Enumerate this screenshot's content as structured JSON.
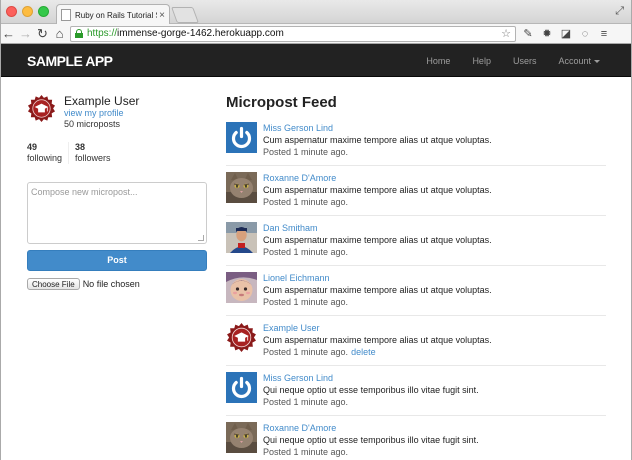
{
  "browser": {
    "tab_title": "Ruby on Rails Tutorial Sam",
    "url_scheme": "https://",
    "url_rest": "immense-gorge-1462.herokuapp.com",
    "icons": [
      "back-icon",
      "forward-icon",
      "reload-icon",
      "home-icon",
      "lock-icon",
      "star-icon",
      "extension-icon",
      "settings-icon",
      "menu-icon"
    ]
  },
  "navbar": {
    "logo": "SAMPLE APP",
    "links": {
      "home": "Home",
      "help": "Help",
      "users": "Users",
      "account": "Account"
    }
  },
  "sidebar": {
    "user_name": "Example User",
    "profile_link": "view my profile",
    "micropost_count": "50 microposts",
    "following_count": "49",
    "following_label": "following",
    "followers_count": "38",
    "followers_label": "followers",
    "compose_placeholder": "Compose new micropost...",
    "post_button": "Post",
    "file_button": "Choose File",
    "file_status": "No file chosen"
  },
  "feed": {
    "title": "Micropost Feed",
    "items": [
      {
        "user": "Miss Gerson Lind",
        "content": "Cum aspernatur maxime tempore alias ut atque voluptas.",
        "time": "Posted 1 minute ago.",
        "avatar": "power-icon"
      },
      {
        "user": "Roxanne D'Amore",
        "content": "Cum aspernatur maxime tempore alias ut atque voluptas.",
        "time": "Posted 1 minute ago.",
        "avatar": "cat-photo"
      },
      {
        "user": "Dan Smitham",
        "content": "Cum aspernatur maxime tempore alias ut atque voluptas.",
        "time": "Posted 1 minute ago.",
        "avatar": "person-photo"
      },
      {
        "user": "Lionel Eichmann",
        "content": "Cum aspernatur maxime tempore alias ut atque voluptas.",
        "time": "Posted 1 minute ago.",
        "avatar": "baby-photo"
      },
      {
        "user": "Example User",
        "content": "Cum aspernatur maxime tempore alias ut atque voluptas.",
        "time": "Posted 1 minute ago.",
        "delete": "delete",
        "avatar": "seal-icon"
      },
      {
        "user": "Miss Gerson Lind",
        "content": "Qui neque optio ut esse temporibus illo vitae fugit sint.",
        "time": "Posted 1 minute ago.",
        "avatar": "power-icon"
      },
      {
        "user": "Roxanne D'Amore",
        "content": "Qui neque optio ut esse temporibus illo vitae fugit sint.",
        "time": "Posted 1 minute ago.",
        "avatar": "cat-photo"
      }
    ]
  },
  "colors": {
    "navbar_bg": "#222222",
    "link": "#428bca",
    "primary_button": "#428bca",
    "seal_red": "#8b1a1a",
    "power_blue": "#2b73b8"
  }
}
